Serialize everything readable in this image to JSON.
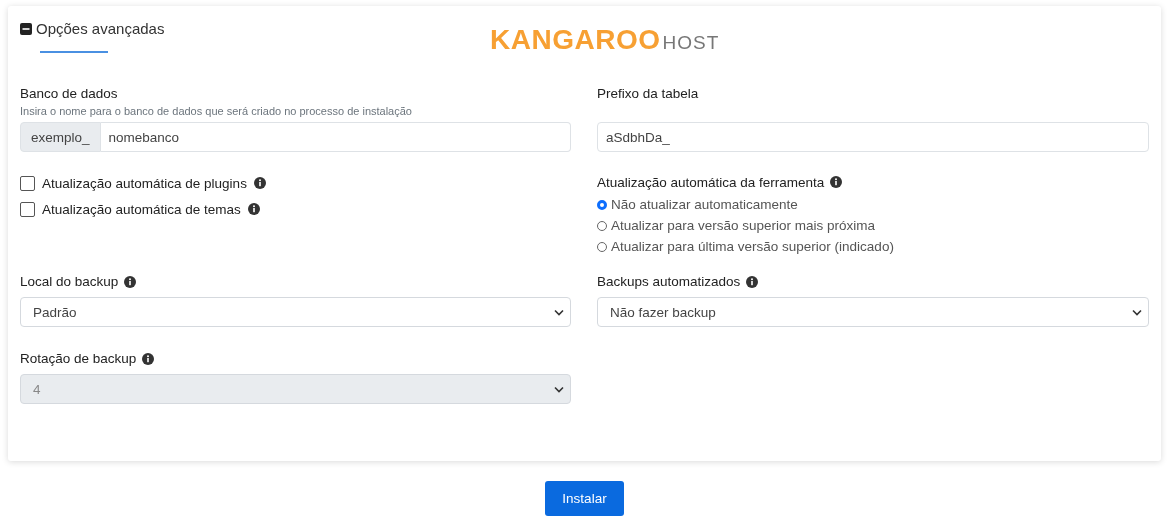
{
  "section": {
    "title": "Opções avançadas",
    "expanded": true
  },
  "logo": {
    "name": "KANGAROO",
    "suffix": "HOST"
  },
  "database": {
    "label": "Banco de dados",
    "hint": "Insira o nome para o banco de dados que será criado no processo de instalação",
    "prefix": "exemplo_",
    "value": "nomebanco"
  },
  "table_prefix": {
    "label": "Prefixo da tabela",
    "value": "aSdbhDa_"
  },
  "auto_updates": [
    {
      "label": "Atualização automática de plugins",
      "checked": false
    },
    {
      "label": "Atualização automática de temas",
      "checked": false
    }
  ],
  "tool_update": {
    "label": "Atualização automática da ferramenta",
    "options": [
      {
        "label": "Não atualizar automaticamente",
        "selected": true
      },
      {
        "label": "Atualizar para versão superior mais próxima",
        "selected": false
      },
      {
        "label": "Atualizar para última versão superior (indicado)",
        "selected": false
      }
    ]
  },
  "backup_location": {
    "label": "Local do backup",
    "value": "Padrão",
    "disabled": false
  },
  "automated_backups": {
    "label": "Backups automatizados",
    "value": "Não fazer backup",
    "disabled": false
  },
  "backup_rotation": {
    "label": "Rotação de backup",
    "value": "4",
    "disabled": true
  },
  "install_button": "Instalar"
}
